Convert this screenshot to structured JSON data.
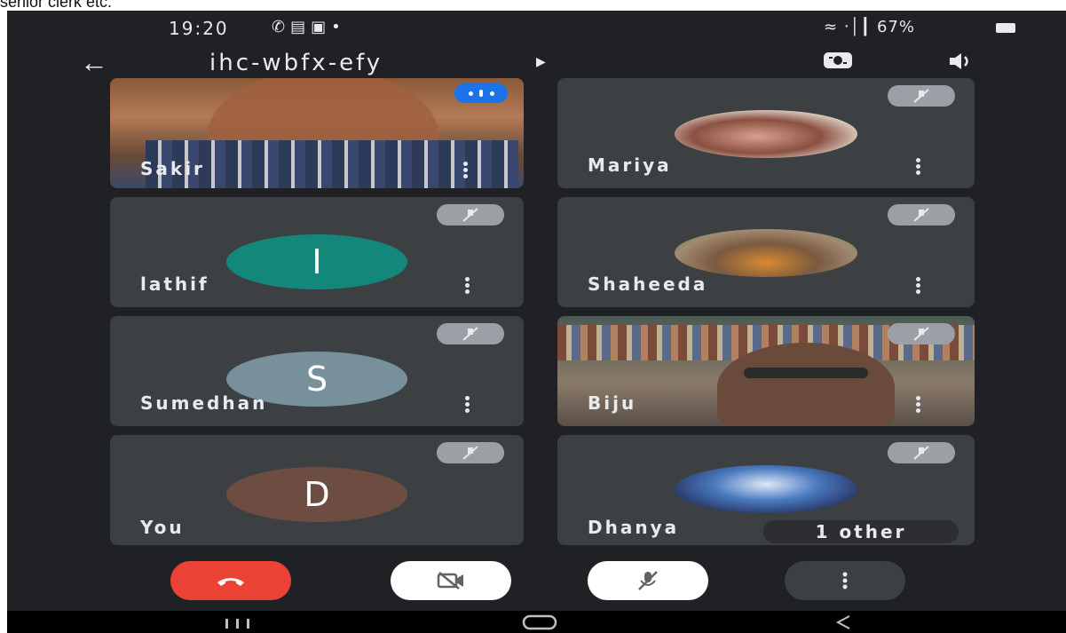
{
  "caption": "senior clerk etc.",
  "status": {
    "time": "19:20",
    "left_icons": [
      "whatsapp-icon",
      "image-icon",
      "calendar-icon",
      "dot-icon"
    ],
    "right_text": "67%",
    "right_icons": [
      "wifi-icon",
      "signal-icon",
      "battery-icon"
    ]
  },
  "header": {
    "meeting_code": "ihc-wbfx-efy",
    "icons": [
      "back-arrow-icon",
      "caret-right-icon",
      "camera-switch-icon",
      "speaker-icon"
    ]
  },
  "participants": [
    {
      "name": "Sakir",
      "type": "video",
      "indicator": "speaking"
    },
    {
      "name": "Mariya",
      "type": "photo",
      "muted": true
    },
    {
      "name": "lathif",
      "type": "initial",
      "initial": "I",
      "color": "#12877a",
      "muted": true
    },
    {
      "name": "Shaheeda",
      "type": "photo",
      "muted": true
    },
    {
      "name": "Sumedhan",
      "type": "initial",
      "initial": "S",
      "color": "#78909c",
      "muted": true
    },
    {
      "name": "Biju",
      "type": "video",
      "muted": true
    },
    {
      "name": "You",
      "type": "initial",
      "initial": "D",
      "color": "#6d4c41",
      "muted": true
    },
    {
      "name": "Dhanya",
      "type": "photo",
      "muted": true
    }
  ],
  "other_count_label": "1 other",
  "controls": {
    "end_call_color": "#ea4335",
    "items": [
      "end-call-icon",
      "camera-off-icon",
      "mic-off-icon",
      "more-options-icon"
    ]
  },
  "navbar": {
    "items": [
      "recent-apps-icon",
      "home-icon",
      "back-icon"
    ]
  }
}
